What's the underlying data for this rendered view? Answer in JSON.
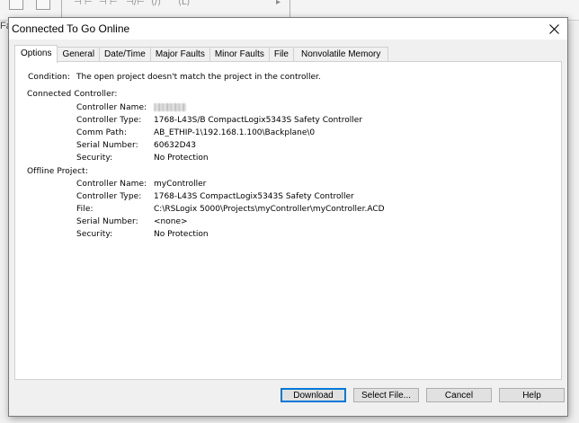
{
  "background": {
    "fragment_text": "Fa"
  },
  "dialog": {
    "title": "Connected To Go Online",
    "tabs": [
      {
        "label": "Options",
        "active": true
      },
      {
        "label": "General",
        "active": false
      },
      {
        "label": "Date/Time",
        "active": false
      },
      {
        "label": "Major Faults",
        "active": false
      },
      {
        "label": "Minor Faults",
        "active": false
      },
      {
        "label": "File",
        "active": false
      },
      {
        "label": "Nonvolatile Memory",
        "active": false
      }
    ],
    "condition_label": "Condition:",
    "condition_text": "The open project doesn't match the project in the controller.",
    "connected_controller": {
      "heading": "Connected Controller:",
      "name_label": "Controller Name:",
      "type_label": "Controller Type:",
      "type_value": "1768-L43S/B CompactLogix5343S Safety Controller",
      "comm_label": "Comm Path:",
      "comm_value": "AB_ETHIP-1\\192.168.1.100\\Backplane\\0",
      "serial_label": "Serial Number:",
      "serial_value": "60632D43",
      "security_label": "Security:",
      "security_value": "No Protection"
    },
    "offline_project": {
      "heading": "Offline Project:",
      "name_label": "Controller Name:",
      "name_value": "myController",
      "type_label": "Controller Type:",
      "type_value": "1768-L43S CompactLogix5343S Safety Controller",
      "file_label": "File:",
      "file_value": "C:\\RSLogix 5000\\Projects\\myController\\myController.ACD",
      "serial_label": "Serial Number:",
      "serial_value": "<none>",
      "security_label": "Security:",
      "security_value": "No Protection"
    },
    "buttons": {
      "download": "Download",
      "select_file": "Select File...",
      "cancel": "Cancel",
      "help": "Help"
    },
    "colors": {
      "default_button_border": "#0078d7",
      "button_face": "#e1e1e1",
      "panel_background": "#ffffff",
      "dialog_background": "#f0f0f0"
    }
  }
}
